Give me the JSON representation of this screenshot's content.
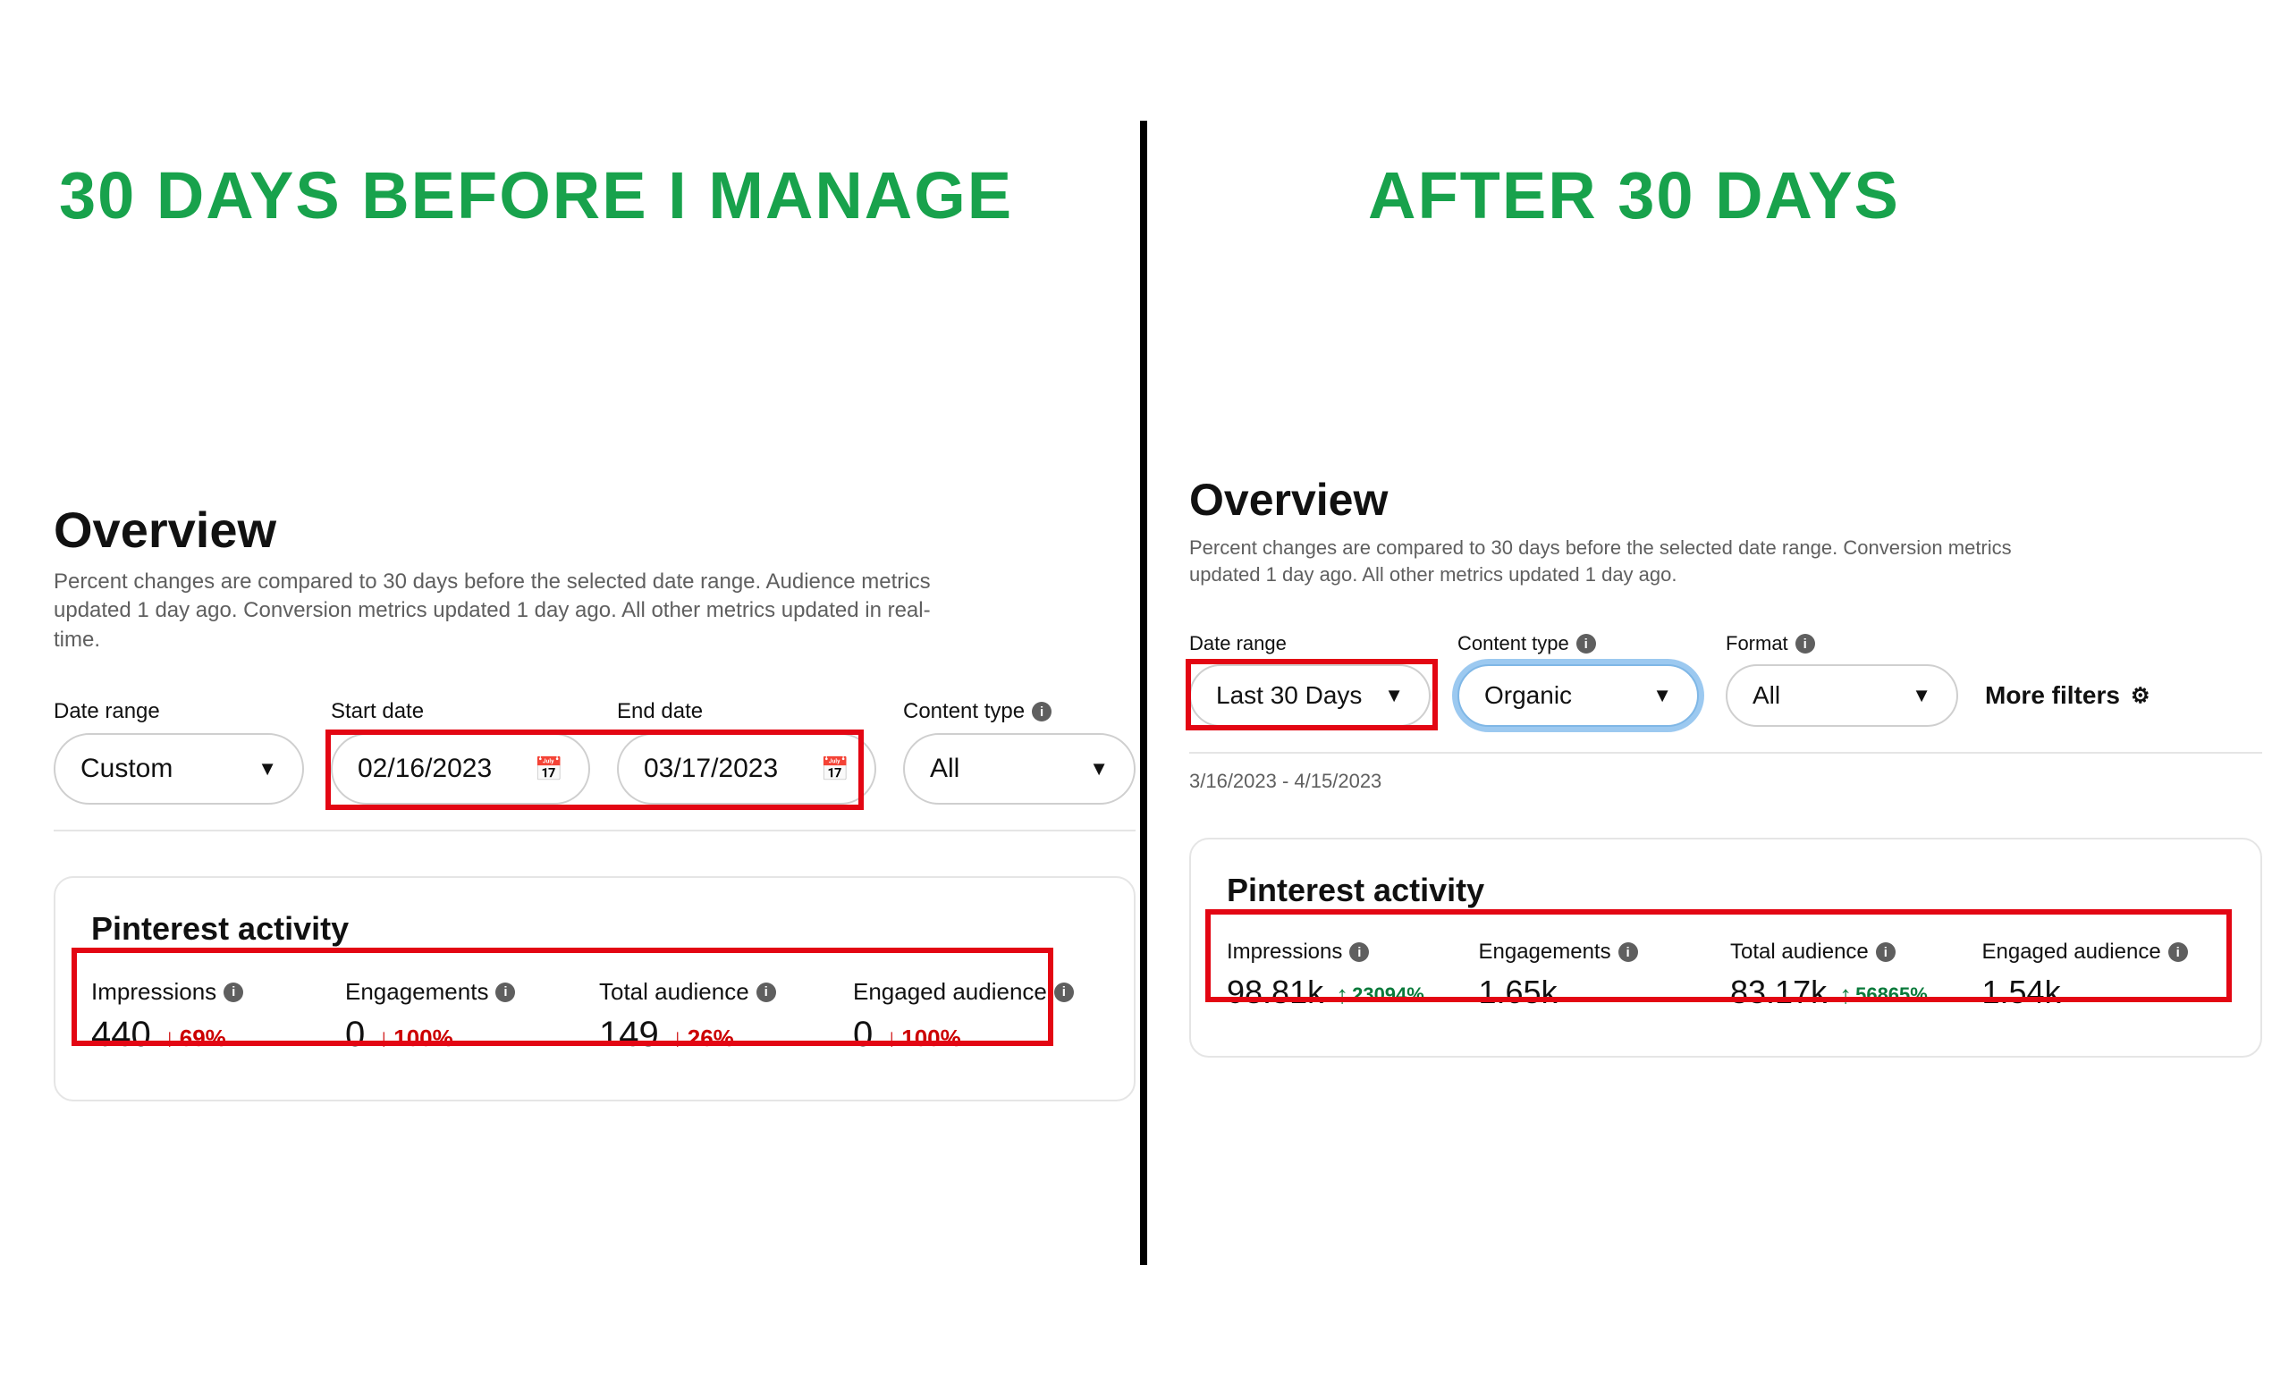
{
  "headlines": {
    "left": "30 DAYS BEFORE I MANAGE",
    "right": "AFTER 30 DAYS"
  },
  "left": {
    "overview_title": "Overview",
    "overview_sub": "Percent changes are compared to 30 days before the selected date range. Audience metrics updated 1 day ago. Conversion metrics updated 1 day ago. All other metrics updated in real-time.",
    "filters": {
      "date_range_label": "Date range",
      "date_range_value": "Custom",
      "start_label": "Start date",
      "start_value": "02/16/2023",
      "end_label": "End date",
      "end_value": "03/17/2023",
      "content_type_label": "Content type",
      "content_type_value": "All"
    },
    "card_title": "Pinterest activity",
    "metrics": {
      "impr_label": "Impressions",
      "impr_value": "440",
      "impr_trend": "69%",
      "eng_label": "Engagements",
      "eng_value": "0",
      "eng_trend": "100%",
      "aud_label": "Total audience",
      "aud_value": "149",
      "aud_trend": "26%",
      "eaud_label": "Engaged audience",
      "eaud_value": "0",
      "eaud_trend": "100%"
    }
  },
  "right": {
    "overview_title": "Overview",
    "overview_sub": "Percent changes are compared to 30 days before the selected date range. Conversion metrics updated 1 day ago. All other metrics updated 1 day ago.",
    "filters": {
      "date_range_label": "Date range",
      "date_range_value": "Last 30 Days",
      "content_type_label": "Content type",
      "content_type_value": "Organic",
      "format_label": "Format",
      "format_value": "All",
      "more_filters": "More filters"
    },
    "date_summary": "3/16/2023 - 4/15/2023",
    "card_title": "Pinterest activity",
    "metrics": {
      "impr_label": "Impressions",
      "impr_value": "98.81k",
      "impr_trend": "23094%",
      "eng_label": "Engagements",
      "eng_value": "1.65k",
      "aud_label": "Total audience",
      "aud_value": "83.17k",
      "aud_trend": "56865%",
      "eaud_label": "Engaged audience",
      "eaud_value": "1.54k"
    }
  }
}
